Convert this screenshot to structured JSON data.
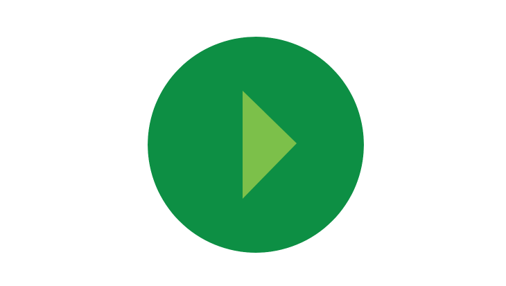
{
  "play_button": {
    "icon": "play-icon",
    "circle_color": "#0d8f44",
    "triangle_color": "#7cc04a"
  }
}
